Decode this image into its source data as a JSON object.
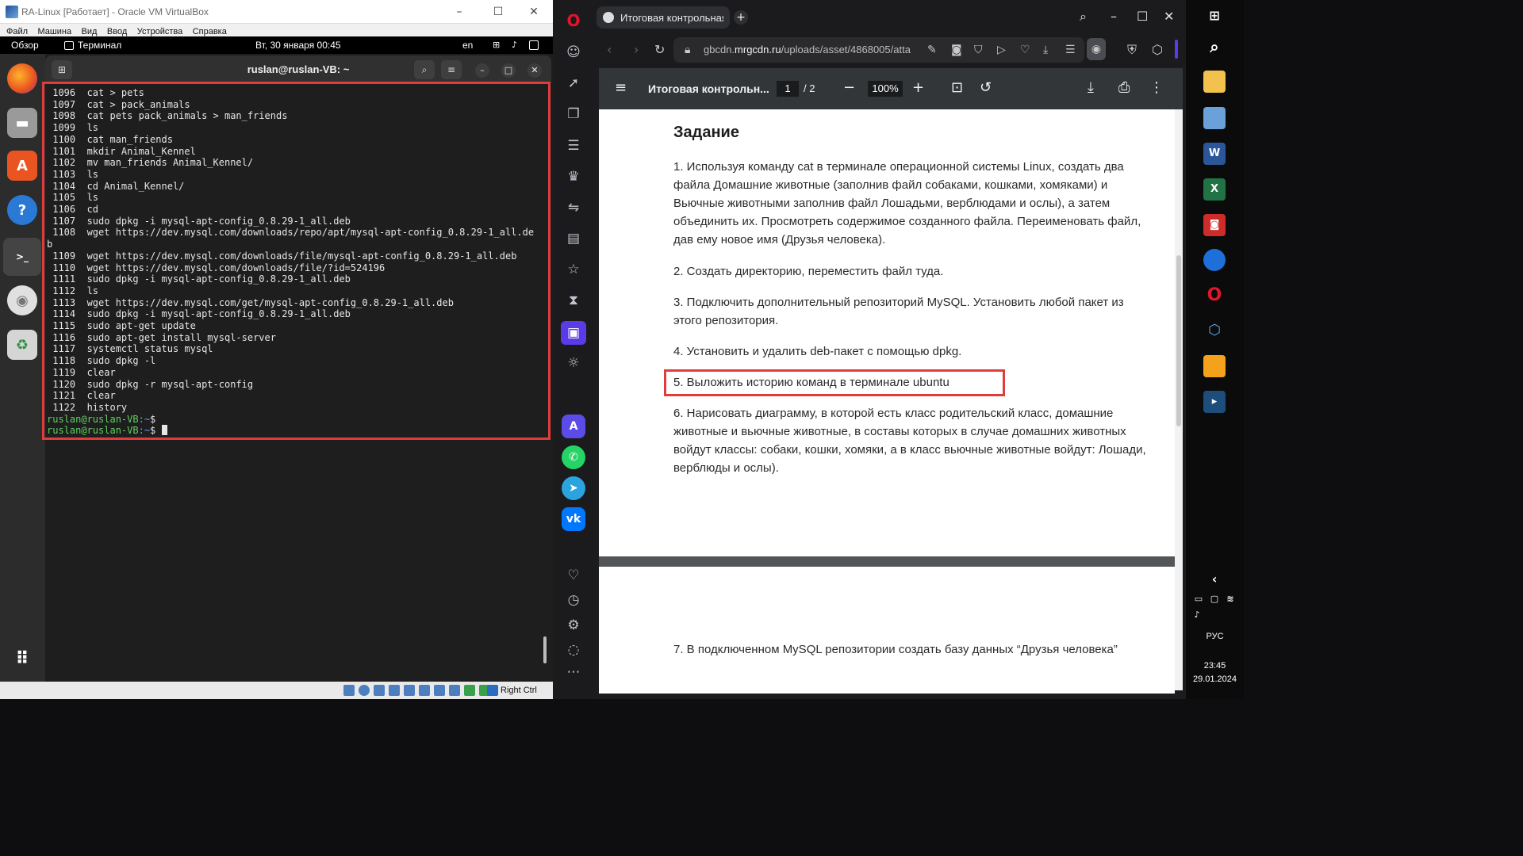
{
  "vbox": {
    "title": "RA-Linux [Работает] - Oracle VM VirtualBox",
    "menu": [
      "Файл",
      "Машина",
      "Вид",
      "Ввод",
      "Устройства",
      "Справка"
    ],
    "status_right": "Right Ctrl"
  },
  "ubuntu_panel": {
    "overview": "Обзор",
    "app": "Терминал",
    "datetime": "Вт, 30 января  00:45",
    "lang": "en"
  },
  "dock": [
    {
      "name": "firefox-icon",
      "color": "#e86a1d"
    },
    {
      "name": "files-icon",
      "color": "#8d8d8d"
    },
    {
      "name": "app-center-icon",
      "color": "#e95420"
    },
    {
      "name": "help-icon",
      "color": "#2a7ad5"
    },
    {
      "name": "terminal-icon",
      "color": "#3a3a3a"
    },
    {
      "name": "disc-icon",
      "color": "#d9d9d9"
    },
    {
      "name": "trash-icon",
      "color": "#cfcfcf"
    }
  ],
  "terminal": {
    "title": "ruslan@ruslan-VB: ~",
    "history": [
      " 1096  cat > pets",
      " 1097  cat > pack_animals",
      " 1098  cat pets pack_animals > man_friends",
      " 1099  ls",
      " 1100  cat man_friends",
      " 1101  mkdir Animal_Kennel",
      " 1102  mv man_friends Animal_Kennel/",
      " 1103  ls",
      " 1104  cd Animal_Kennel/",
      " 1105  ls",
      " 1106  cd",
      " 1107  sudo dpkg -i mysql-apt-config_0.8.29-1_all.deb",
      " 1108  wget https://dev.mysql.com/downloads/repo/apt/mysql-apt-config_0.8.29-1_all.de",
      "b",
      " 1109  wget https://dev.mysql.com/downloads/file/mysql-apt-config_0.8.29-1_all.deb",
      " 1110  wget https://dev.mysql.com/downloads/file/?id=524196",
      " 1111  sudo dpkg -i mysql-apt-config_0.8.29-1_all.deb",
      " 1112  ls",
      " 1113  wget https://dev.mysql.com/get/mysql-apt-config_0.8.29-1_all.deb",
      " 1114  sudo dpkg -i mysql-apt-config_0.8.29-1_all.deb",
      " 1115  sudo apt-get update",
      " 1116  sudo apt-get install mysql-server",
      " 1117  systemctl status mysql",
      " 1118  sudo dpkg -l",
      " 1119  clear",
      " 1120  sudo dpkg -r mysql-apt-config",
      " 1121  clear",
      " 1122  history"
    ],
    "prompt_user": "ruslan@ruslan-VB",
    "prompt_path": ":~",
    "prompt_symbol": "$"
  },
  "browser": {
    "tab_title": "Итоговая контрольная р",
    "url_prefix": "gbcdn.",
    "url_domain": "mrgcdn.ru",
    "url_rest": "/uploads/asset/4868005/atta"
  },
  "pdf": {
    "title": "Итоговая контрольн...",
    "page_current": "1",
    "page_total": "/  2",
    "zoom": "100%",
    "heading": "Задание",
    "tasks": [
      "1. Используя команду cat в терминале операционной системы Linux, создать два файла Домашние животные (заполнив файл собаками, кошками, хомяками) и Вьючные животными заполнив файл Лошадьми, верблюдами и ослы), а затем объединить их. Просмотреть содержимое созданного файла. Переименовать файл, дав ему новое имя (Друзья человека).",
      "2. Создать директорию, переместить файл туда.",
      "3. Подключить дополнительный репозиторий MySQL. Установить любой пакет из этого репозитория.",
      "4. Установить и удалить deb-пакет с помощью dpkg.",
      "5. Выложить историю команд в терминале ubuntu",
      "6. Нарисовать диаграмму, в которой есть класс родительский класс, домашние животные и вьючные животные, в составы которых в случае домашних животных войдут классы: собаки, кошки, хомяки, а в класс вьючные животные войдут: Лошади, верблюды и ослы).",
      "7. В подключенном MySQL репозитории создать базу данных “Друзья человека”"
    ]
  },
  "win_taskbar": {
    "lang": "РУС",
    "time": "23:45",
    "date": "29.01.2024"
  },
  "colors": {
    "highlight": "#e03c3c",
    "prompt_user": "#5fd35f",
    "prompt_path": "#6a9bf0",
    "opera_red": "#e0162b",
    "sidebar_active": "#5b3be8"
  }
}
